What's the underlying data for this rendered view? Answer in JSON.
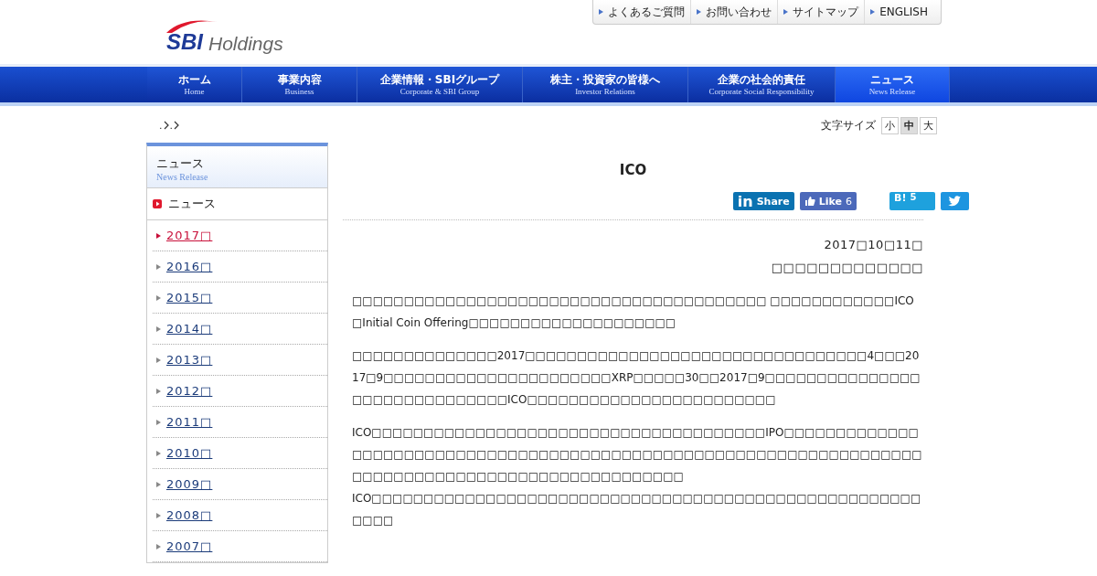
{
  "header": {
    "logo_mark": "SBI",
    "logo_text": "Holdings",
    "top_links": [
      "よくあるご質問",
      "お問い合わせ",
      "サイトマップ",
      "ENGLISH"
    ]
  },
  "nav": [
    {
      "label": "ホーム",
      "sublabel": "Home",
      "selected": false
    },
    {
      "label": "事業内容",
      "sublabel": "Business",
      "selected": false
    },
    {
      "label": "企業情報・SBIグループ",
      "sublabel": "Corporate & SBI Group",
      "selected": false
    },
    {
      "label": "株主・投資家の皆様へ",
      "sublabel": "Investor Relations",
      "selected": false
    },
    {
      "label": "企業の社会的責任",
      "sublabel": "Corporate Social Responsibility",
      "selected": false
    },
    {
      "label": "ニュース",
      "sublabel": "News Release",
      "selected": true
    }
  ],
  "breadcrumb": [
    ".",
    "."
  ],
  "font_size": {
    "label": "文字サイズ",
    "options": [
      {
        "label": "小",
        "selected": false
      },
      {
        "label": "中",
        "selected": true
      },
      {
        "label": "大",
        "selected": false
      }
    ]
  },
  "sidebar": {
    "title": "ニュース",
    "subtitle": "News Release",
    "section": "ニュース",
    "years": [
      {
        "label": "2017□",
        "selected": true
      },
      {
        "label": "2016□",
        "selected": false
      },
      {
        "label": "2015□",
        "selected": false
      },
      {
        "label": "2014□",
        "selected": false
      },
      {
        "label": "2013□",
        "selected": false
      },
      {
        "label": "2012□",
        "selected": false
      },
      {
        "label": "2011□",
        "selected": false
      },
      {
        "label": "2010□",
        "selected": false
      },
      {
        "label": "2009□",
        "selected": false
      },
      {
        "label": "2008□",
        "selected": false
      },
      {
        "label": "2007□",
        "selected": false
      }
    ]
  },
  "article": {
    "title": "ICO",
    "share": {
      "linkedin_logo": "in",
      "linkedin": "Share",
      "facebook": "Like",
      "facebook_count": "6",
      "hatena_logo": "B!",
      "hatena_count": "5"
    },
    "date": "2017□10□11□",
    "author": "□□□□□□□□□□□□□",
    "paragraphs": [
      "□□□□□□□□□□□□□□□□□□□□□□□□□□□□□□□□□□□□□□□□ □□□□□□□□□□□□ICO□Initial Coin Offering□□□□□□□□□□□□□□□□□□□□",
      "□□□□□□□□□□□□□□2017□□□□□□□□□□□□□□□□□□□□□□□□□□□□□□□□□4□□□2017□9□□□□□□□□□□□□□□□□□□□□□□XRP□□□□□30□□2017□9□□□□□□□□□□□□□□□□□□□□□□□□□□□□□□ICO□□□□□□□□□□□□□□□□□□□□□□□□",
      "ICO□□□□□□□□□□□□□□□□□□□□□□□□□□□□□□□□□□□□□□IPO□□□□□□□□□□□□□□□□□□□□□□□□□□□□□□□□□□□□□□□□□□□□□□□□□□□□□□□□□□□□□□□□□□□□□□□□□□□□□□□□□□□□□□□□□□□□□□□□□□□□\nICO□□□□□□□□□□□□□□□□□□□□□□□□□□□□□□□□□□□□□□□□□□□□□□□□□□□□□□□□□"
    ]
  }
}
